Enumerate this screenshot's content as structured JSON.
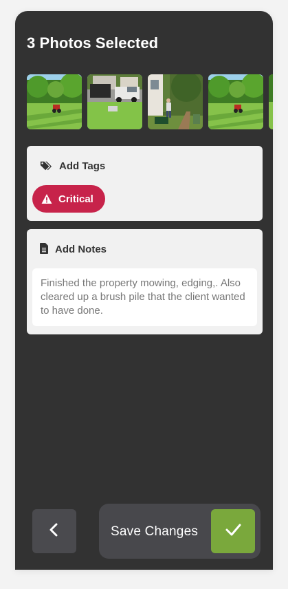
{
  "header": {
    "title": "3 Photos Selected"
  },
  "photos": [
    {
      "icon": "lawn-tractor-photo"
    },
    {
      "icon": "truck-trailer-photo"
    },
    {
      "icon": "worker-mower-photo"
    },
    {
      "icon": "lawn-tractor-photo"
    }
  ],
  "tags": {
    "label": "Add Tags",
    "icon": "tag-icon",
    "chips": [
      {
        "label": "Critical",
        "icon": "warning-icon",
        "color": "#c7234a"
      }
    ]
  },
  "notes": {
    "label": "Add Notes",
    "icon": "note-icon",
    "value": "Finished the property mowing, edging,. Also cleared up a brush pile that the client wanted to have done."
  },
  "footer": {
    "back_icon": "chevron-left-icon",
    "save_label": "Save Changes",
    "confirm_icon": "check-icon",
    "confirm_color": "#7aa83c"
  }
}
